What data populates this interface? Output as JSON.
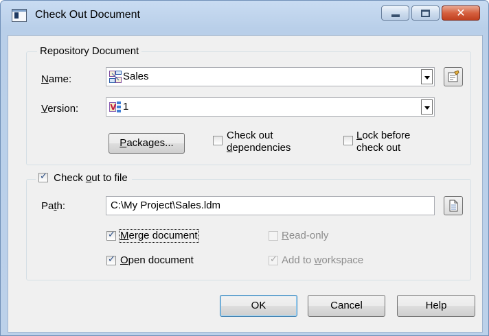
{
  "window": {
    "title": "Check Out Document",
    "close_glyph": "✕"
  },
  "repository_group": {
    "legend": "Repository Document",
    "name_label_u": "N",
    "name_label_rest": "ame:",
    "name_value": "Sales",
    "version_label_u": "V",
    "version_label_rest": "ersion:",
    "version_value": "1",
    "packages_u": "P",
    "packages_rest": "ackages...",
    "dependencies_line1": "Check out",
    "dependencies_u": "d",
    "dependencies_rest": "ependencies",
    "dependencies_checked": false,
    "lock_u": "L",
    "lock_rest": "ock before",
    "lock_line2": "check out",
    "lock_checked": false
  },
  "file_group": {
    "checkout_pre": "Check ",
    "checkout_u": "o",
    "checkout_rest": "ut to file",
    "checkout_checked": true,
    "path_label_pre": "Pa",
    "path_label_u": "t",
    "path_label_rest": "h:",
    "path_value": "C:\\My Project\\Sales.ldm",
    "merge_u": "M",
    "merge_rest": "erge document",
    "merge_checked": true,
    "open_u": "O",
    "open_rest": "pen document",
    "open_checked": true,
    "readonly_u": "R",
    "readonly_rest": "ead-only",
    "readonly_checked": false,
    "workspace_pre": "Add to ",
    "workspace_u": "w",
    "workspace_rest": "orkspace",
    "workspace_checked": true
  },
  "buttons": {
    "ok": "OK",
    "cancel": "Cancel",
    "help": "Help"
  },
  "icons": {
    "app": "window-app-icon",
    "model": "data-model-icon",
    "version": "version-icon",
    "properties": "properties-icon",
    "browse": "browse-file-icon"
  },
  "glyphs": {
    "check": "✓"
  }
}
